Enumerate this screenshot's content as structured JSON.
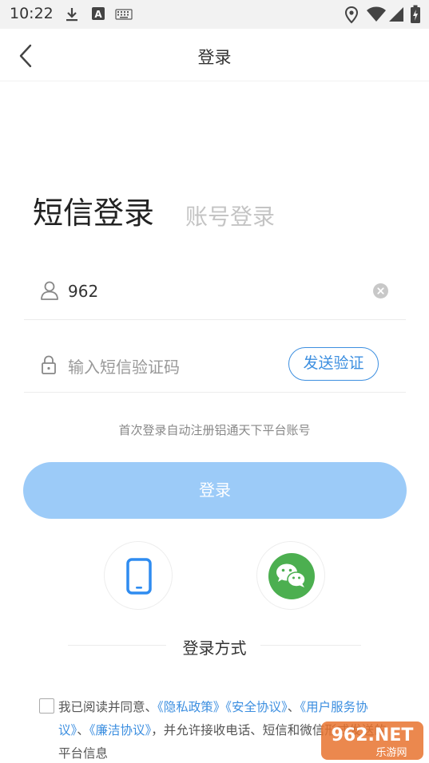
{
  "status_bar": {
    "time": "10:22",
    "left_icons": [
      "download-icon",
      "a-badge-icon",
      "keyboard-icon"
    ],
    "right_icons": [
      "location-icon",
      "wifi-icon",
      "signal-icon",
      "battery-icon"
    ],
    "a_badge": "A"
  },
  "header": {
    "title": "登录",
    "back_icon": "chevron-left-icon"
  },
  "tabs": {
    "sms_login": "短信登录",
    "account_login": "账号登录"
  },
  "form": {
    "phone_value": "962",
    "code_placeholder": "输入短信验证码",
    "send_code_label": "发送验证"
  },
  "notice": "首次登录自动注册铝通天下平台账号",
  "login_button": "登录",
  "methods": {
    "title": "登录方式",
    "items": [
      "phone-icon",
      "wechat-icon"
    ]
  },
  "agreement": {
    "prefix": "我已阅读并同意、",
    "privacy": "《隐私政策》",
    "security": "《安全协议》",
    "sep1": "、",
    "user_service": "《用户服务协议》",
    "sep2": "、",
    "integrity": "《廉洁协议》",
    "suffix": "，并允许接收电话、短信和微信形式发送的平台信息"
  },
  "watermark": {
    "brand": "962.NET",
    "sub": "乐游网"
  },
  "colors": {
    "accent": "#3d8fe0",
    "login_button": "#9ccbf8",
    "wechat": "#4caf50",
    "status_bar": "#f2f2f2"
  }
}
